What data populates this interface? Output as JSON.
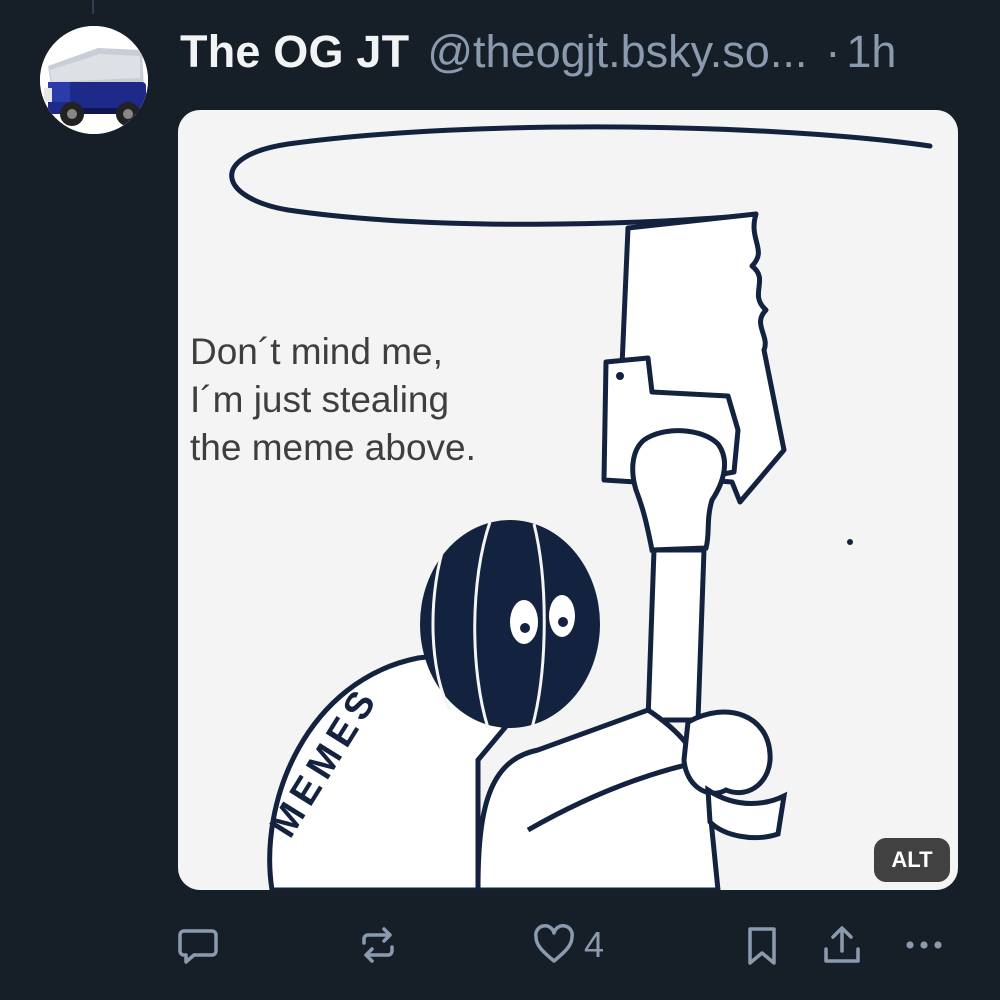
{
  "post": {
    "author": {
      "display_name": "The OG JT",
      "handle": "@theogjt.bsky.so...",
      "avatar_icon": "zamboni-avatar-icon"
    },
    "separator": "·",
    "timestamp": "1h",
    "media": {
      "meme_text_lines": [
        "Don´t mind me,",
        "I´m just stealing",
        "the meme above."
      ],
      "memes_label": "MEMES",
      "alt_badge": "ALT"
    },
    "actions": {
      "reply_icon": "reply-icon",
      "repost_icon": "repost-icon",
      "like_icon": "heart-icon",
      "like_count": "4",
      "bookmark_icon": "bookmark-icon",
      "share_icon": "share-icon",
      "more_icon": "more-icon"
    }
  },
  "colors": {
    "background": "#161e27",
    "text_primary": "#f1f3f5",
    "text_secondary": "#8a9bb0",
    "meme_navy": "#13233f"
  }
}
